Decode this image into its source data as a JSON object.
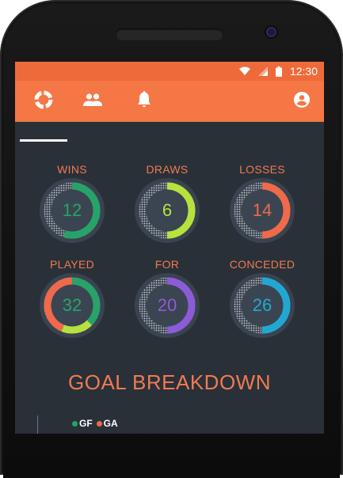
{
  "status_bar": {
    "time": "12:30",
    "icons": [
      "wifi-icon",
      "signal-icon",
      "battery-icon"
    ]
  },
  "app_bar": {
    "tabs": [
      {
        "name": "dashboard",
        "icon": "donut-chart-icon",
        "selected": true
      },
      {
        "name": "team",
        "icon": "people-icon",
        "selected": false
      },
      {
        "name": "notifications",
        "icon": "bell-icon",
        "selected": false
      }
    ],
    "profile_icon": "account-circle-icon"
  },
  "stats": [
    {
      "label": "WINS",
      "value": "12",
      "color": "#27a36a",
      "fraction": 0.55
    },
    {
      "label": "DRAWS",
      "value": "6",
      "color": "#b6e23d",
      "fraction": 0.5
    },
    {
      "label": "LOSSES",
      "value": "14",
      "color": "#ee6a4a",
      "fraction": 0.5
    },
    {
      "label": "PLAYED",
      "value": "32",
      "color": "#27a36a",
      "segments": [
        {
          "color": "#27a36a",
          "fraction": 0.375
        },
        {
          "color": "#b6e23d",
          "fraction": 0.1875
        },
        {
          "color": "#ee6a4a",
          "fraction": 0.4375
        }
      ]
    },
    {
      "label": "FOR",
      "value": "20",
      "color": "#8c5bd8",
      "fraction": 0.5
    },
    {
      "label": "CONCEDED",
      "value": "26",
      "color": "#21a8d2",
      "fraction": 0.5
    }
  ],
  "goal_breakdown": {
    "title": "GOAL BREAKDOWN",
    "legend": [
      {
        "label": "GF",
        "color": "#27a36a"
      },
      {
        "label": "GA",
        "color": "#ee6a4a"
      }
    ]
  },
  "colors": {
    "accent": "#f47745",
    "status_bar": "#ef6a3b",
    "background": "#293038",
    "label": "#f07a52"
  }
}
